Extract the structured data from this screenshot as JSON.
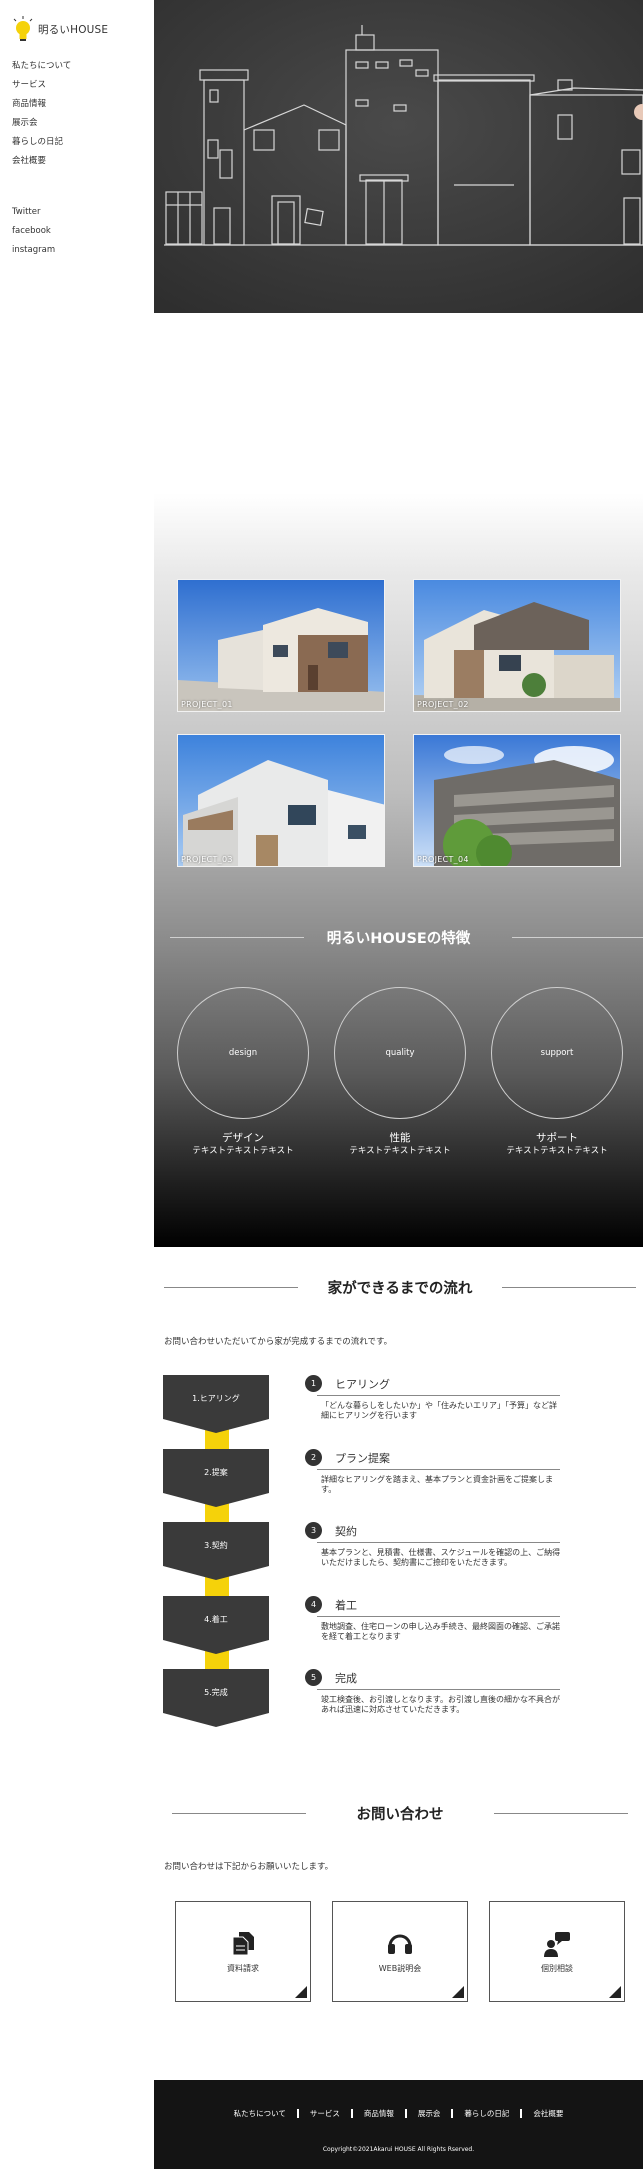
{
  "brand": {
    "name": "明るいHOUSE",
    "accent": "#f5d20a"
  },
  "nav": [
    "私たちについて",
    "サービス",
    "商品情報",
    "展示会",
    "暮らしの日記",
    "会社概要"
  ],
  "social": [
    "Twitter",
    "facebook",
    "instagram"
  ],
  "works": {
    "title": "",
    "cards": [
      {
        "caption": "PROJECT_01"
      },
      {
        "caption": "PROJECT_02"
      },
      {
        "caption": "PROJECT_03"
      },
      {
        "caption": "PROJECT_04"
      }
    ]
  },
  "features": {
    "title": "明るいHOUSEの特徴",
    "items": [
      {
        "circle": "design",
        "name": "デザイン",
        "desc": "テキストテキストテキスト"
      },
      {
        "circle": "quality",
        "name": "性能",
        "desc": "テキストテキストテキスト"
      },
      {
        "circle": "support",
        "name": "サポート",
        "desc": "テキストテキストテキスト"
      }
    ]
  },
  "flow": {
    "title": "家ができるまでの流れ",
    "intro": "お問い合わせいただいてから家が完成するまでの流れです。",
    "steps": [
      {
        "label": "1.ヒアリング",
        "num": "1",
        "title": "ヒアリング",
        "text": "「どんな暮らしをしたいか」や「住みたいエリア」「予算」など詳細にヒアリングを行います"
      },
      {
        "label": "2.提案",
        "num": "2",
        "title": "プラン提案",
        "text": "詳細なヒアリングを踏まえ、基本プランと資金計画をご提案します。"
      },
      {
        "label": "3.契約",
        "num": "3",
        "title": "契約",
        "text": "基本プランと、見積書、仕様書、スケジュールを確認の上、ご納得いただけましたら、契約書にご捺印をいただきます。"
      },
      {
        "label": "4.着工",
        "num": "4",
        "title": "着工",
        "text": "敷地調査、住宅ローンの申し込み手続き、最終図面の確認、ご承諾を経て着工となります"
      },
      {
        "label": "5.完成",
        "num": "5",
        "title": "完成",
        "text": "竣工検査後、お引渡しとなります。お引渡し直後の細かな不具合があれば迅速に対応させていただきます。"
      }
    ]
  },
  "contact": {
    "title": "お問い合わせ",
    "intro": "お問い合わせは下記からお願いいたします。",
    "items": [
      {
        "label": "資料請求",
        "icon": "document-icon"
      },
      {
        "label": "WEB説明会",
        "icon": "headphones-icon"
      },
      {
        "label": "個別相談",
        "icon": "consultation-icon"
      }
    ]
  },
  "footer": {
    "nav": [
      "私たちについて",
      "サービス",
      "商品情報",
      "展示会",
      "暮らしの日記",
      "会社概要"
    ],
    "copyright": "Copyright©2021Akarui HOUSE All Rights Rserved."
  }
}
